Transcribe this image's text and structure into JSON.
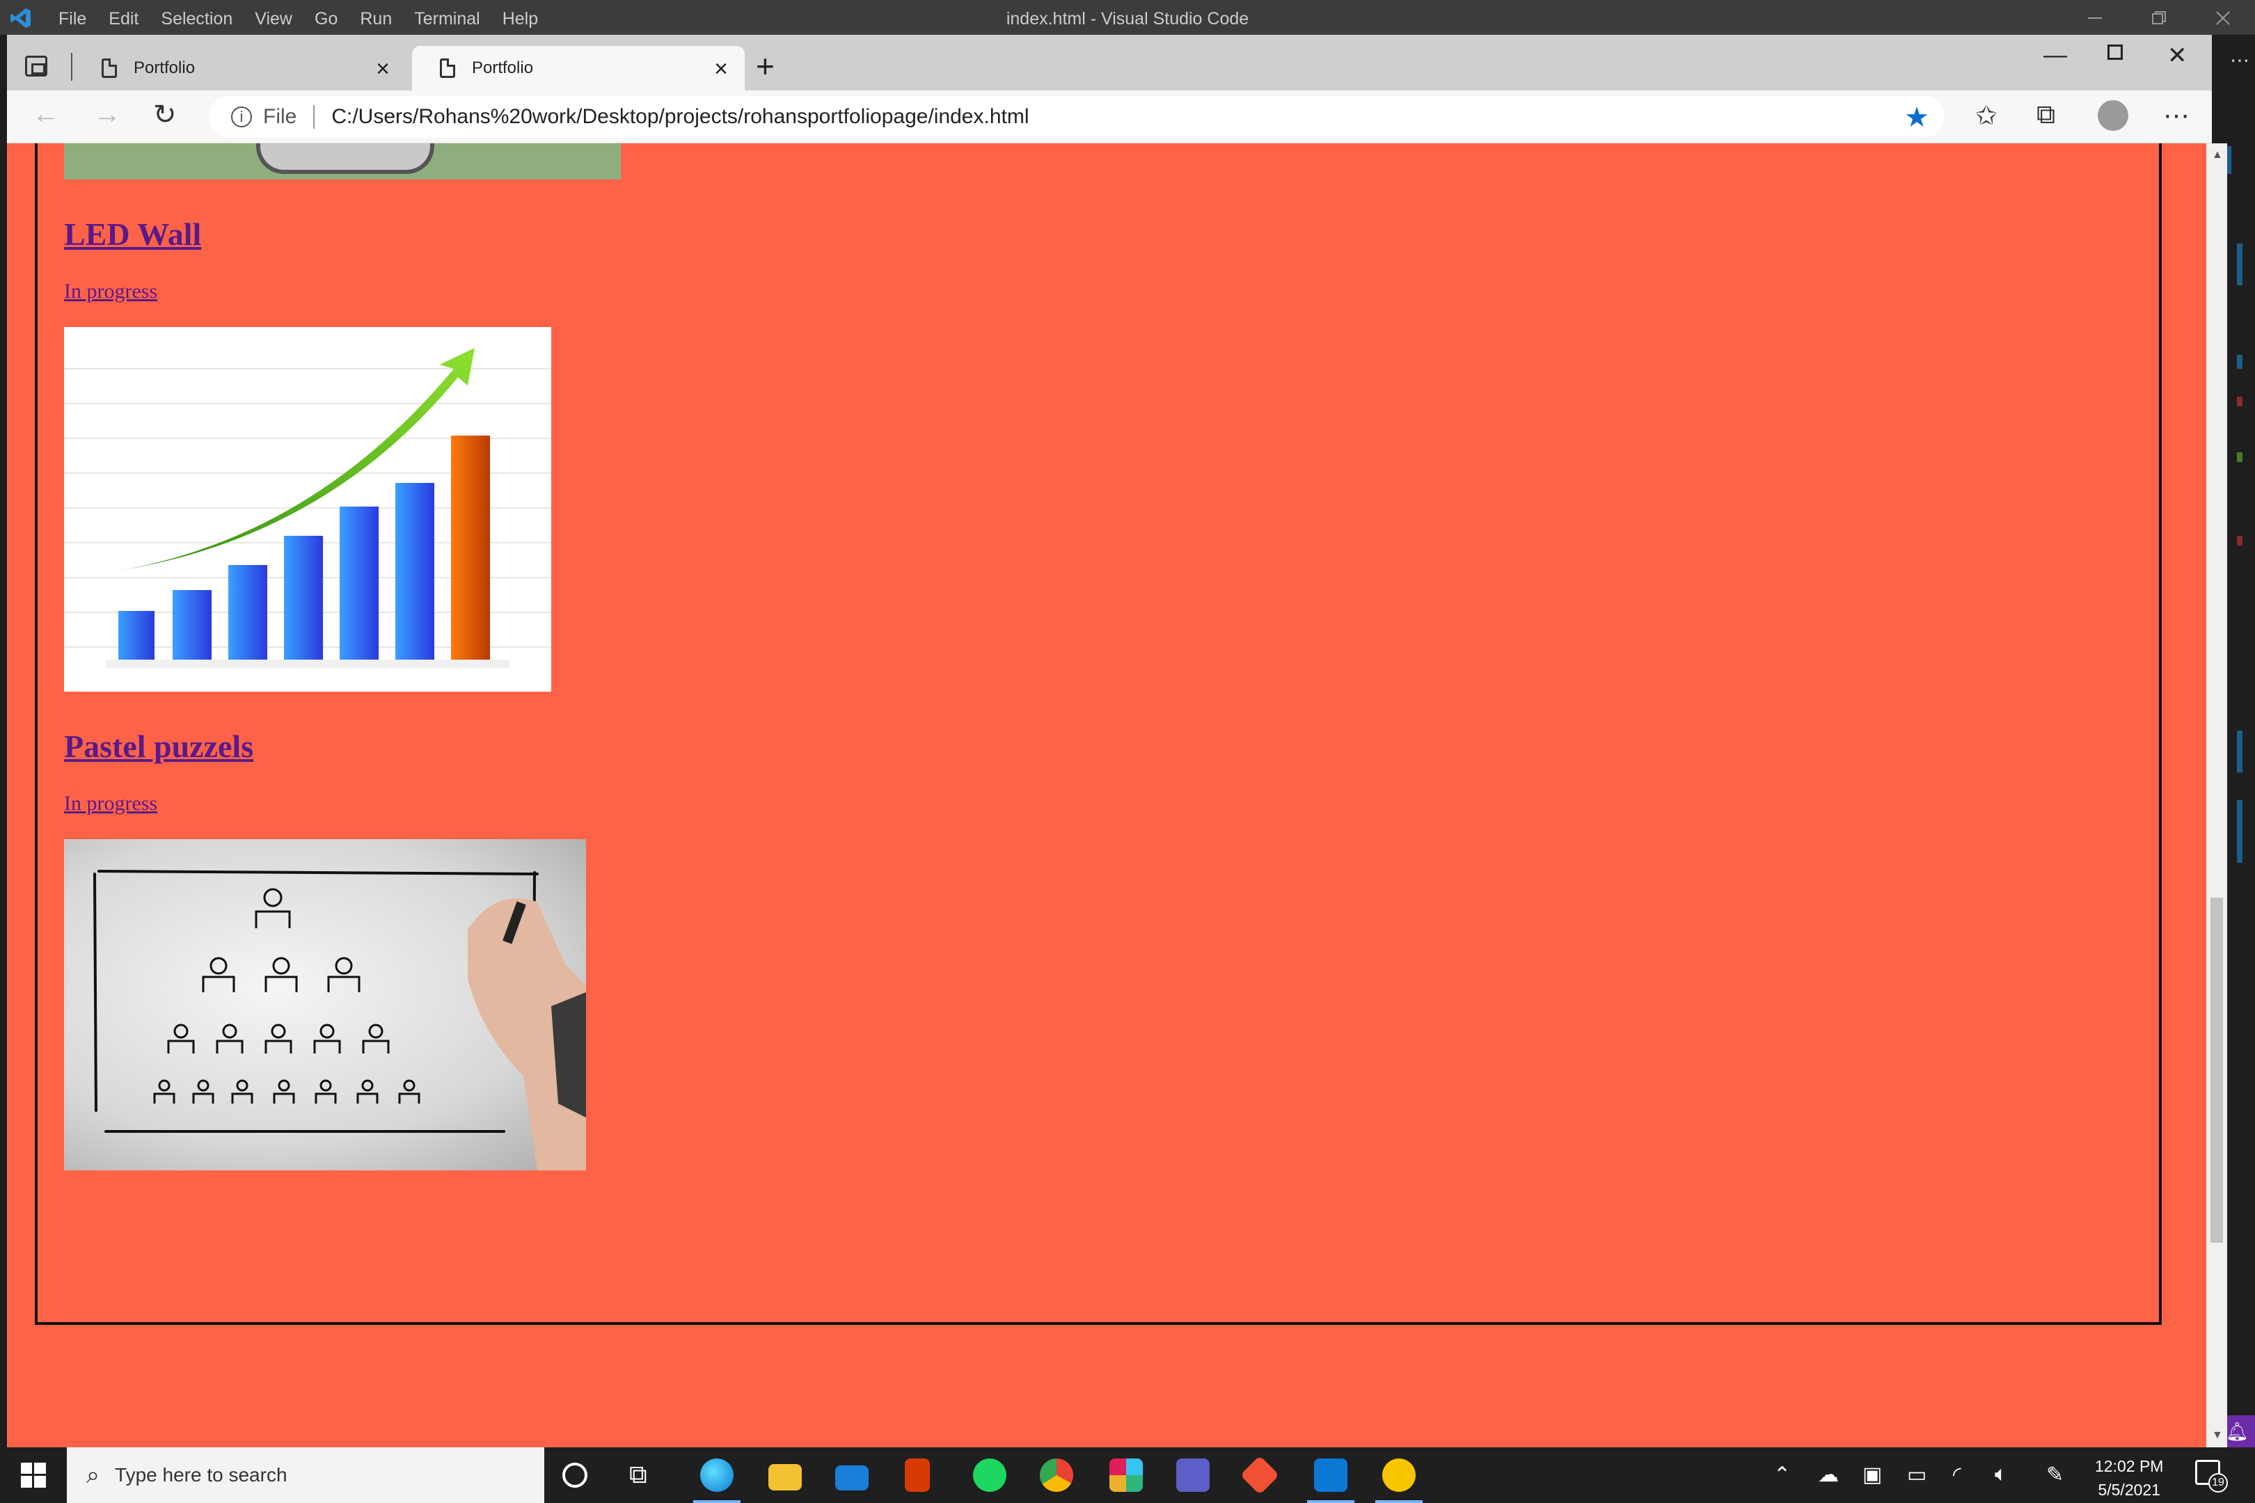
{
  "vscode": {
    "menu": [
      "File",
      "Edit",
      "Selection",
      "View",
      "Go",
      "Run",
      "Terminal",
      "Help"
    ],
    "title": "index.html - Visual Studio Code"
  },
  "browser": {
    "tabs": [
      {
        "label": "Portfolio",
        "active": false
      },
      {
        "label": "Portfolio",
        "active": true
      }
    ],
    "address": {
      "scheme_label": "File",
      "url": "C:/Users/Rohans%20work/Desktop/projects/rohansportfoliopage/index.html"
    }
  },
  "page": {
    "background": "#ff6347",
    "projects": [
      {
        "title": "LED Wall",
        "status": "In progress",
        "image": "growth-bar-chart-image"
      },
      {
        "title": "Pastel puzzels",
        "status": "In progress",
        "image": "org-chart-drawing-image"
      }
    ]
  },
  "taskbar": {
    "search_placeholder": "Type here to search",
    "apps": [
      "task-view",
      "edge",
      "file-explorer",
      "mail",
      "office",
      "spotify",
      "chrome",
      "slack",
      "teams",
      "git",
      "vscode",
      "norton"
    ],
    "time": "12:02 PM",
    "date": "5/5/2021",
    "notification_count": "19"
  }
}
